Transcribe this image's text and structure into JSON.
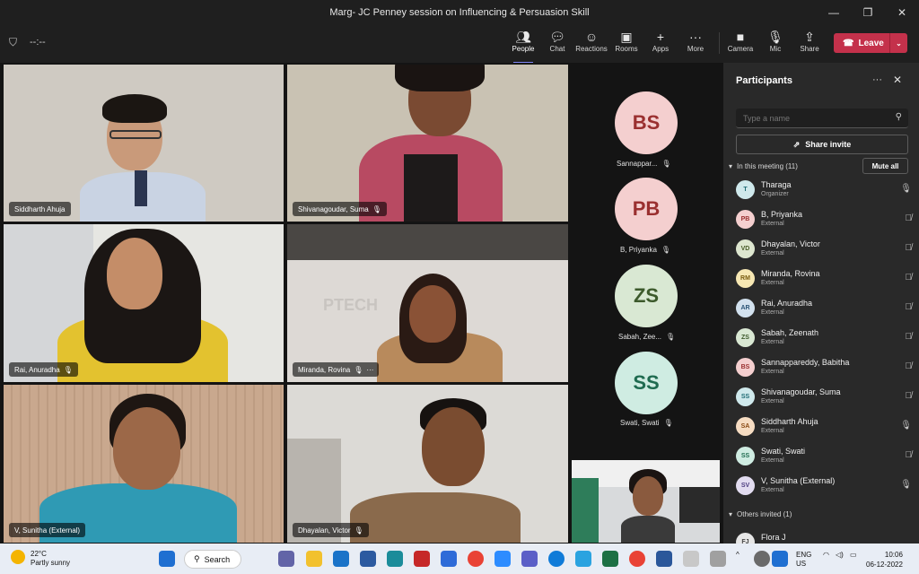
{
  "window": {
    "title": "Marg- JC Penney session on Influencing & Persuasion Skill",
    "minimize": "—",
    "maximize": "❐",
    "close": "✕"
  },
  "toolbar": {
    "timer": "--:--",
    "buttons": [
      {
        "label": "People",
        "icon": "people-icon"
      },
      {
        "label": "Chat",
        "icon": "chat-icon"
      },
      {
        "label": "Reactions",
        "icon": "reactions-icon"
      },
      {
        "label": "Rooms",
        "icon": "rooms-icon"
      },
      {
        "label": "Apps",
        "icon": "apps-icon"
      },
      {
        "label": "More",
        "icon": "more-icon"
      },
      {
        "label": "Camera",
        "icon": "camera-icon"
      },
      {
        "label": "Mic",
        "icon": "mic-icon"
      },
      {
        "label": "Share",
        "icon": "share-icon"
      }
    ],
    "leave_label": "Leave"
  },
  "videos": [
    {
      "name": "Siddharth Ahuja"
    },
    {
      "name": "Shivanagoudar, Suma"
    },
    {
      "name": "Rai, Anuradha"
    },
    {
      "name": "Miranda, Rovina"
    },
    {
      "name": "V, Sunitha (External)"
    },
    {
      "name": "Dhayalan, Victor"
    }
  ],
  "avatars": [
    {
      "initials": "BS",
      "name": "Sannappar...",
      "color": "#f4cfcf",
      "text": "#9a3030"
    },
    {
      "initials": "PB",
      "name": "B, Priyanka",
      "color": "#f4cfcf",
      "text": "#9a3030"
    },
    {
      "initials": "ZS",
      "name": "Sabah, Zee...",
      "color": "#d9e8d3",
      "text": "#3d5a2c"
    },
    {
      "initials": "SS",
      "name": "Swati, Swati",
      "color": "#cfece2",
      "text": "#1f6b50"
    }
  ],
  "panel": {
    "title": "Participants",
    "search_placeholder": "Type a name",
    "share_invite": "Share invite",
    "in_meeting": "In this meeting (11)",
    "mute_all": "Mute all",
    "others": "Others invited (1)",
    "participants": [
      {
        "initials": "T",
        "name": "Tharaga",
        "role": "Organizer",
        "color": "#cfe9ec",
        "text": "#1f6b74",
        "mic": "on"
      },
      {
        "initials": "PB",
        "name": "B, Priyanka",
        "role": "External",
        "color": "#f4cfcf",
        "text": "#9a3030",
        "mic": "off"
      },
      {
        "initials": "VD",
        "name": "Dhayalan, Victor",
        "role": "External",
        "color": "#dde6cf",
        "text": "#4a5d2a",
        "mic": "off"
      },
      {
        "initials": "RM",
        "name": "Miranda, Rovina",
        "role": "External",
        "color": "#f6e7b3",
        "text": "#7a5c10",
        "mic": "off"
      },
      {
        "initials": "AR",
        "name": "Rai, Anuradha",
        "role": "External",
        "color": "#d2e1ee",
        "text": "#2c5577",
        "mic": "off"
      },
      {
        "initials": "ZS",
        "name": "Sabah, Zeenath",
        "role": "External",
        "color": "#d9e8d3",
        "text": "#3d5a2c",
        "mic": "off"
      },
      {
        "initials": "BS",
        "name": "Sannappareddy, Babitha",
        "role": "External",
        "color": "#f4cfcf",
        "text": "#9a3030",
        "mic": "off"
      },
      {
        "initials": "SS",
        "name": "Shivanagoudar, Suma",
        "role": "External",
        "color": "#cfe9ec",
        "text": "#1f6b74",
        "mic": "off"
      },
      {
        "initials": "SA",
        "name": "Siddharth Ahuja",
        "role": "External",
        "color": "#f6dcc2",
        "text": "#8a4a14",
        "mic": "on"
      },
      {
        "initials": "SS",
        "name": "Swati, Swati",
        "role": "External",
        "color": "#cfece2",
        "text": "#1f6b50",
        "mic": "off"
      },
      {
        "initials": "SV",
        "name": "V, Sunitha (External)",
        "role": "External",
        "color": "#e2dcf0",
        "text": "#4d3d80",
        "mic": "on"
      }
    ],
    "others_list": [
      {
        "initials": "FJ",
        "name": "Flora J",
        "color": "#e6e6e6",
        "text": "#444"
      }
    ]
  },
  "taskbar": {
    "temperature": "22°C",
    "weather": "Partly sunny",
    "search": "Search",
    "lang": "ENG",
    "region": "US",
    "time": "10:06",
    "date": "06-12-2022"
  }
}
